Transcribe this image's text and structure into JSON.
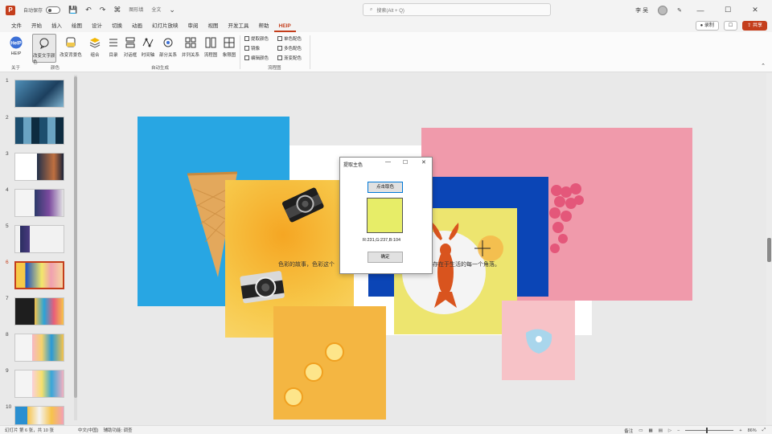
{
  "titlebar": {
    "autosave_label": "自动保存",
    "toggle_state": "关",
    "qa_text": "图形填",
    "qa_text2": "全文",
    "search_placeholder": "搜索(Alt + Q)",
    "user_name": "李 吴",
    "minimize": "—",
    "maximize": "☐",
    "close": "✕"
  },
  "tabs": {
    "items": [
      "文件",
      "开始",
      "插入",
      "绘图",
      "设计",
      "切换",
      "动画",
      "幻灯片放映",
      "审阅",
      "视图",
      "开发工具",
      "帮助",
      "HEIP"
    ],
    "active_index": 12,
    "record_label": "录制",
    "share_label": "共享"
  },
  "ribbon": {
    "buttons": [
      "HEIP",
      "改变文字颜色",
      "改变背景色",
      "组合",
      "目录",
      "对话框",
      "时间轴",
      "部分关系",
      "并列关系",
      "流程图",
      "象限图"
    ],
    "checks": [
      "提取颜色",
      "镜像",
      "编辑颜色",
      "单色配色",
      "多色配色",
      "渐变配色"
    ],
    "group_labels": [
      "关于",
      "颜色",
      "自动生成",
      "流程图"
    ]
  },
  "thumbnails": {
    "numbers": [
      "1",
      "2",
      "3",
      "4",
      "5",
      "6",
      "7",
      "8",
      "9",
      "10"
    ],
    "active_index": 5
  },
  "slide": {
    "text_left": "色彩的故事，色彩这个",
    "text_right": "存在于生活的每一个角落。"
  },
  "dialog": {
    "title": "提取主色",
    "pick_button": "点击取色",
    "rgb_text": "R:231,G:237,B:104",
    "ok_button": "确定",
    "swatch_color": "#e7ed68"
  },
  "statusbar": {
    "slide_info": "幻灯片 第 6 张，共 10 张",
    "language": "中文(中国)",
    "accessibility": "辅助功能: 调查",
    "notes": "备注",
    "zoom": "86%"
  },
  "colors": {
    "accent": "#c43e1c"
  }
}
